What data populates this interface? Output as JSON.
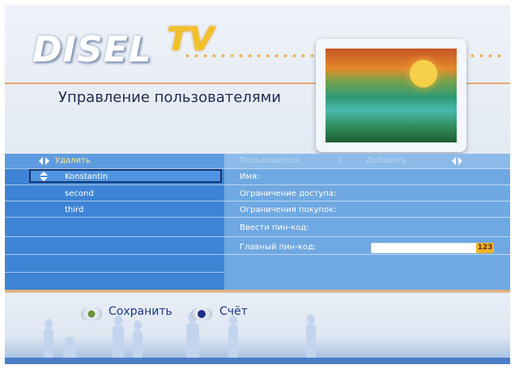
{
  "header": {
    "logo_main": "DISEL",
    "logo_accent": "TV",
    "page_title": "Управление пользователями"
  },
  "left_panel": {
    "action_label": "Удалить",
    "users": [
      "Konstantin",
      "second",
      "third"
    ],
    "selected_index": 0
  },
  "right_panel": {
    "tabs": [
      {
        "label": "Пользователи",
        "active": false
      },
      {
        "label": "Добавить",
        "active": false
      }
    ],
    "fields": [
      {
        "label": "Имя:"
      },
      {
        "label": "Ограничение доступа:"
      },
      {
        "label": "Ограничения покупок:"
      },
      {
        "label": "Ввести пин-код:"
      },
      {
        "label": "Главный пин-код:"
      }
    ],
    "pin_badge": "123"
  },
  "footer": {
    "save_label": "Сохранить",
    "account_label": "Счёт"
  },
  "colors": {
    "left_panel": "#3d84d4",
    "right_panel": "#6fa8e2",
    "accent_orange": "#e6a86e",
    "title_text": "#1c2a4e",
    "footer_text": "#1e3a86"
  },
  "icons": {
    "left_right_arrows": "left-right-arrows-icon",
    "up_down_arrows": "up-down-arrows-icon",
    "save_button_icon": "green-button-icon",
    "account_button_icon": "blue-button-icon"
  }
}
